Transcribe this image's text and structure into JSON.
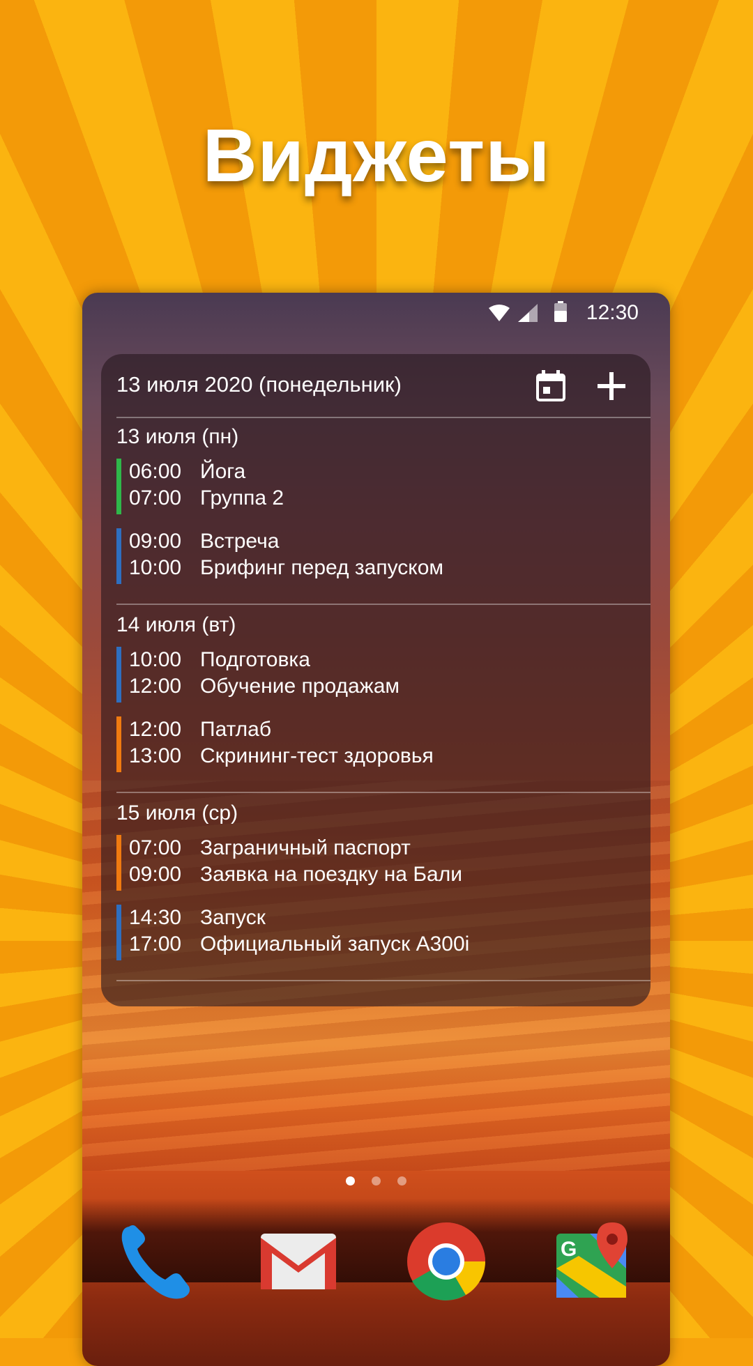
{
  "headline": "Виджеты",
  "status": {
    "time": "12:30"
  },
  "widget": {
    "title": "13 июля 2020 (понедельник)",
    "days": [
      {
        "label": "13 июля (пн)",
        "events": [
          {
            "start": "06:00",
            "end": "07:00",
            "title": "Йога",
            "subtitle": "Группа 2",
            "color": "#2fb84a"
          },
          {
            "start": "09:00",
            "end": "10:00",
            "title": "Встреча",
            "subtitle": "Брифинг перед запуском",
            "color": "#2e6fc0"
          }
        ]
      },
      {
        "label": "14 июля (вт)",
        "events": [
          {
            "start": "10:00",
            "end": "12:00",
            "title": "Подготовка",
            "subtitle": "Обучение продажам",
            "color": "#2e6fc0"
          },
          {
            "start": "12:00",
            "end": "13:00",
            "title": "Патлаб",
            "subtitle": "Скрининг-тест здоровья",
            "color": "#f07a10"
          }
        ]
      },
      {
        "label": "15 июля (ср)",
        "events": [
          {
            "start": "07:00",
            "end": "09:00",
            "title": "Заграничный паспорт",
            "subtitle": "Заявка на поездку на Бали",
            "color": "#f07a10"
          },
          {
            "start": "14:30",
            "end": "17:00",
            "title": "Запуск",
            "subtitle": "Официальный запуск A300i",
            "color": "#2e6fc0"
          }
        ]
      }
    ]
  },
  "pager": {
    "count": 3,
    "active": 0
  },
  "dock": [
    "phone-app-icon",
    "gmail-app-icon",
    "chrome-app-icon",
    "maps-app-icon"
  ]
}
